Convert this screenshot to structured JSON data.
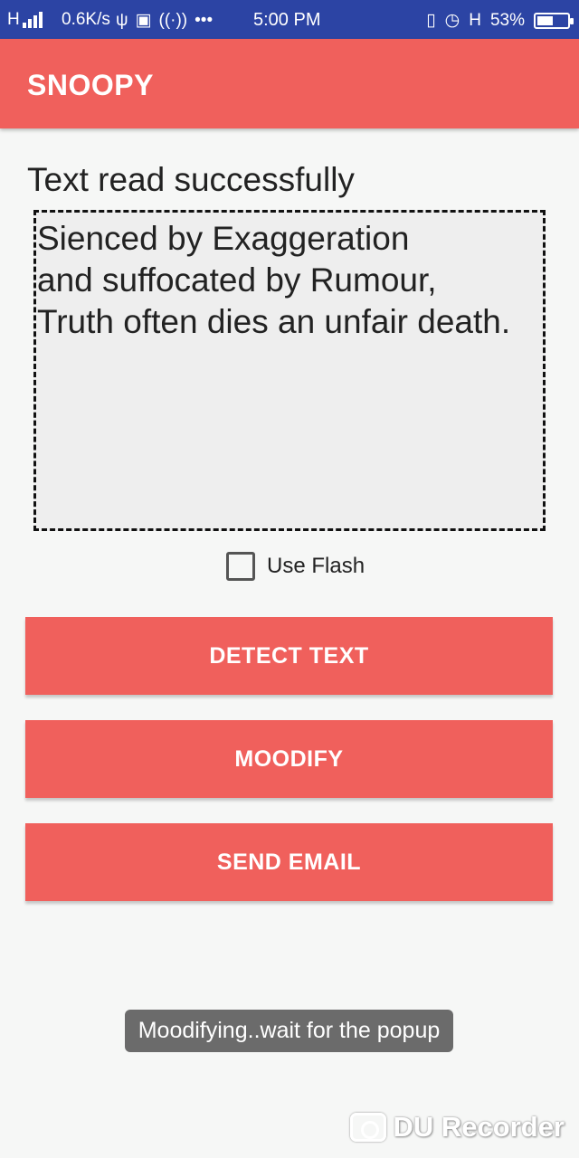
{
  "status_bar": {
    "network": "H",
    "speed": "0.6K/s",
    "time": "5:00 PM",
    "network2": "H",
    "battery": "53%",
    "battery_level": 0.53
  },
  "app_bar": {
    "title": "SNOOPY",
    "color": "#f0605c"
  },
  "main": {
    "status_text": "Text read successfully",
    "detected_lines": [
      "Sienced by Exaggeration",
      "and suffocated by Rumour,",
      "Truth often dies an unfair death."
    ],
    "flash_label": "Use Flash",
    "flash_checked": false
  },
  "buttons": {
    "detect": "DETECT TEXT",
    "moodify": "MOODIFY",
    "email": "SEND EMAIL"
  },
  "toast": "Moodifying..wait for the popup",
  "watermark": "DU Recorder"
}
